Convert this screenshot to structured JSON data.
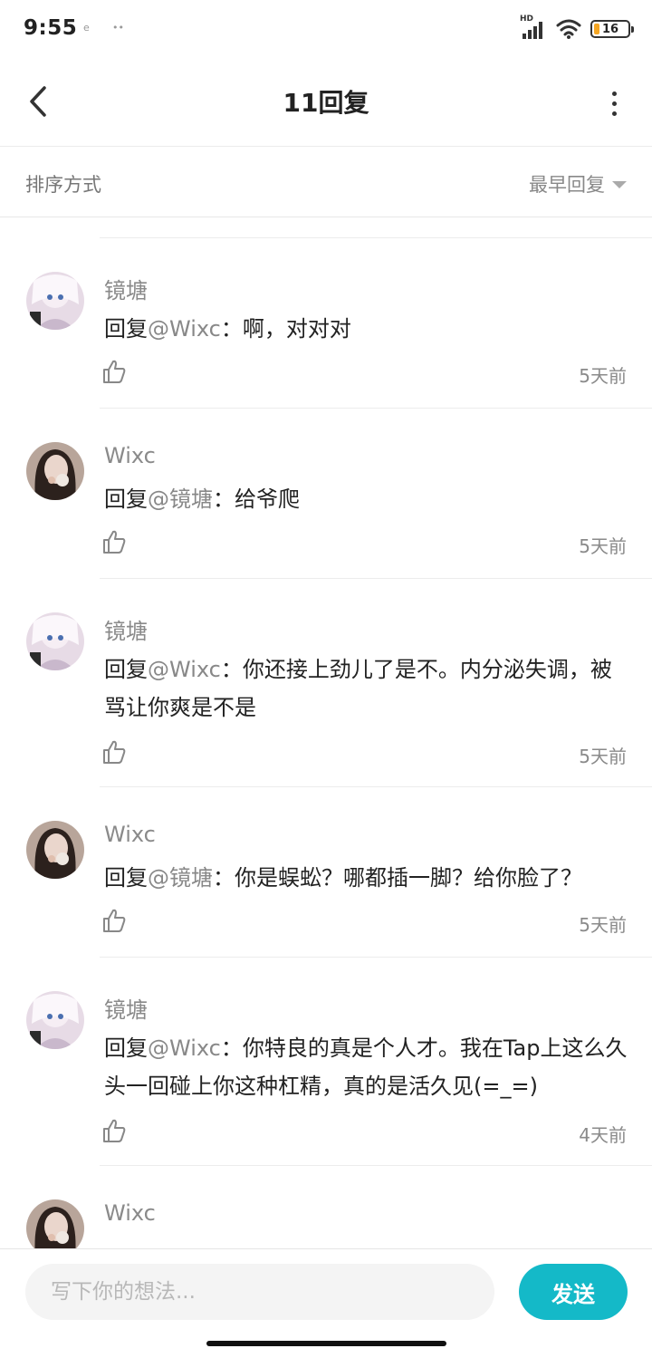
{
  "status_bar": {
    "time": "9:55",
    "mini_icons": [
      "e",
      "••"
    ],
    "network_label": "HD",
    "battery_level": "16",
    "battery_percent": 16
  },
  "nav": {
    "title": "11回复",
    "back_icon": "chevron-left-icon",
    "more_icon": "more-vertical-icon"
  },
  "sort": {
    "label": "排序方式",
    "selected": "最早回复"
  },
  "comments": [
    {
      "author": "镜塘",
      "avatar": "pink",
      "prefix": "回复",
      "mention": "@Wixc",
      "text": "：啊，对对对",
      "time": "5天前"
    },
    {
      "author": "Wixc",
      "avatar": "dark",
      "prefix": "回复",
      "mention": "@镜塘",
      "text": "：给爷爬",
      "time": "5天前"
    },
    {
      "author": "镜塘",
      "avatar": "pink",
      "prefix": "回复",
      "mention": "@Wixc",
      "text": "：你还接上劲儿了是不。内分泌失调，被骂让你爽是不是",
      "time": "5天前"
    },
    {
      "author": "Wixc",
      "avatar": "dark",
      "prefix": "回复",
      "mention": "@镜塘",
      "text": "：你是蜈蚣？哪都插一脚？给你脸了？",
      "time": "5天前"
    },
    {
      "author": "镜塘",
      "avatar": "pink",
      "prefix": "回复",
      "mention": "@Wixc",
      "text": "：你特良的真是个人才。我在Tap上这么久头一回碰上你这种杠精，真的是活久见(=_=)",
      "time": "4天前"
    },
    {
      "author": "Wixc",
      "avatar": "dark",
      "prefix": "",
      "mention": "",
      "text": "",
      "time": ""
    }
  ],
  "composer": {
    "placeholder": "写下你的想法...",
    "send_label": "发送"
  },
  "colors": {
    "accent": "#14b9c8",
    "text_primary": "#222222",
    "text_secondary": "#8a8a8a"
  }
}
